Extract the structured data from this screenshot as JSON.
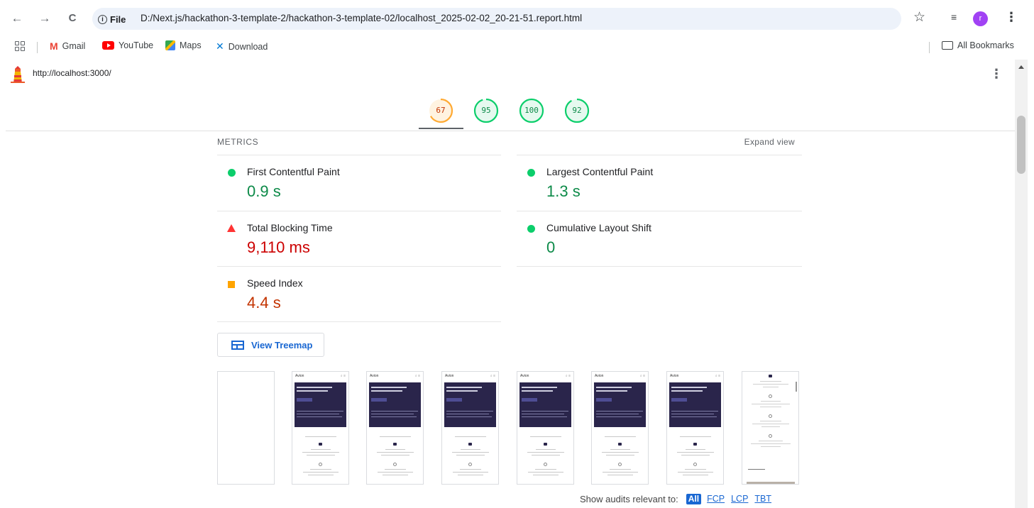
{
  "browser": {
    "back_glyph": "←",
    "forward_glyph": "→",
    "reload_glyph": "C",
    "site_chip": "File",
    "url": "D:/Next.js/hackathon-3-template-2/hackathon-3-template-02/localhost_2025-02-02_20-21-51.report.html",
    "avatar_letter": "r",
    "star_glyph": "☆",
    "ext_glyph": "≡",
    "menu_glyph": "⋮"
  },
  "bookmarks": {
    "items": [
      {
        "label": "Gmail",
        "icon": "gmail-icon"
      },
      {
        "label": "YouTube",
        "icon": "youtube-icon"
      },
      {
        "label": "Maps",
        "icon": "maps-icon"
      },
      {
        "label": "Download",
        "icon": "vscode-icon"
      }
    ],
    "all_bookmarks": "All Bookmarks"
  },
  "lighthouse": {
    "tested_url": "http://localhost:3000/",
    "kebab_glyph": "⋮",
    "scores": [
      {
        "value": "67",
        "color": "#fa3",
        "text_color": "#c33300",
        "fraction": 0.67
      },
      {
        "value": "95",
        "color": "#0cce6b",
        "text_color": "#0c8a48",
        "fraction": 0.95
      },
      {
        "value": "100",
        "color": "#0cce6b",
        "text_color": "#0c8a48",
        "fraction": 1.0
      },
      {
        "value": "92",
        "color": "#0cce6b",
        "text_color": "#0c8a48",
        "fraction": 0.92
      }
    ]
  },
  "metrics": {
    "title": "METRICS",
    "expand_label": "Expand view",
    "items": [
      {
        "label": "First Contentful Paint",
        "value": "0.9 s",
        "status": "pass"
      },
      {
        "label": "Largest Contentful Paint",
        "value": "1.3 s",
        "status": "pass"
      },
      {
        "label": "Total Blocking Time",
        "value": "9,110 ms",
        "status": "fail"
      },
      {
        "label": "Cumulative Layout Shift",
        "value": "0",
        "status": "pass"
      },
      {
        "label": "Speed Index",
        "value": "4.4 s",
        "status": "average"
      }
    ],
    "treemap_label": "View Treemap"
  },
  "filmstrip": {
    "brand": "Avion",
    "frame_count": 8
  },
  "audits": {
    "filter_label": "Show audits relevant to:",
    "chips": [
      "All",
      "FCP",
      "LCP",
      "TBT"
    ]
  }
}
